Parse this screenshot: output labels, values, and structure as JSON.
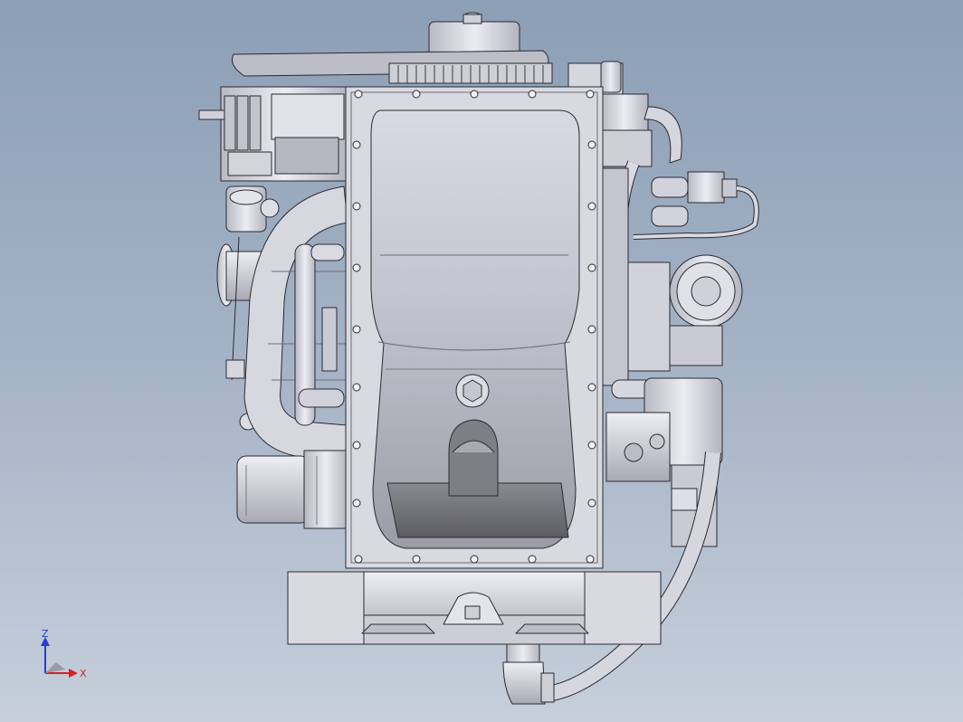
{
  "viewport": {
    "background_top": "#8c9fb6",
    "background_bottom": "#c6cfdb",
    "model": "engine-assembly-bottom-view"
  },
  "triad": {
    "z_label": "Z",
    "x_label": "X",
    "z_color": "#1f3fd6",
    "x_color": "#d8201f"
  },
  "colors": {
    "metal_light": "#e6e6ee",
    "metal_mid": "#c9c9d3",
    "metal_dark": "#8e8e99",
    "edge": "#2a2a30",
    "pan_shadow": "#6f6f74"
  }
}
